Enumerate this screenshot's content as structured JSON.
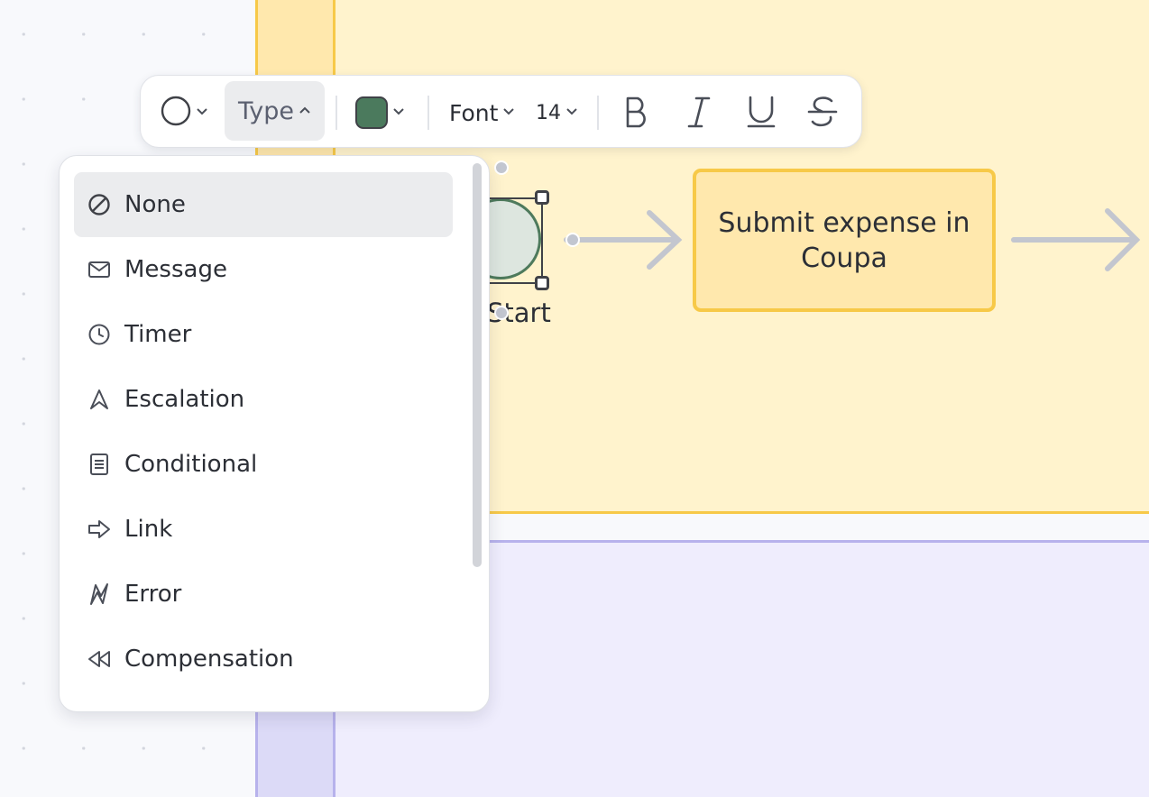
{
  "canvas": {
    "task": {
      "label": "Submit expense in Coupa"
    },
    "start_event": {
      "label": "Start"
    }
  },
  "toolbar": {
    "shape_icon": "circle-icon",
    "type_label": "Type",
    "fill_color": "#4b7a5d",
    "font_label": "Font",
    "font_size": "14",
    "format_icons": [
      "bold-icon",
      "italic-icon",
      "underline-icon",
      "strikethrough-icon"
    ]
  },
  "type_menu": {
    "items": [
      {
        "label": "None",
        "icon": "none-icon",
        "selected": true
      },
      {
        "label": "Message",
        "icon": "envelope-icon"
      },
      {
        "label": "Timer",
        "icon": "clock-icon"
      },
      {
        "label": "Escalation",
        "icon": "escalation-icon"
      },
      {
        "label": "Conditional",
        "icon": "document-icon"
      },
      {
        "label": "Link",
        "icon": "link-arrow-icon"
      },
      {
        "label": "Error",
        "icon": "error-bolt-icon"
      },
      {
        "label": "Compensation",
        "icon": "rewind-icon"
      }
    ]
  },
  "colors": {
    "lane_yellow": "#fff3cd",
    "lane_yellow_border": "#f7c948",
    "lane_purple": "#efedfd",
    "accent_green": "#4b7a5d"
  }
}
